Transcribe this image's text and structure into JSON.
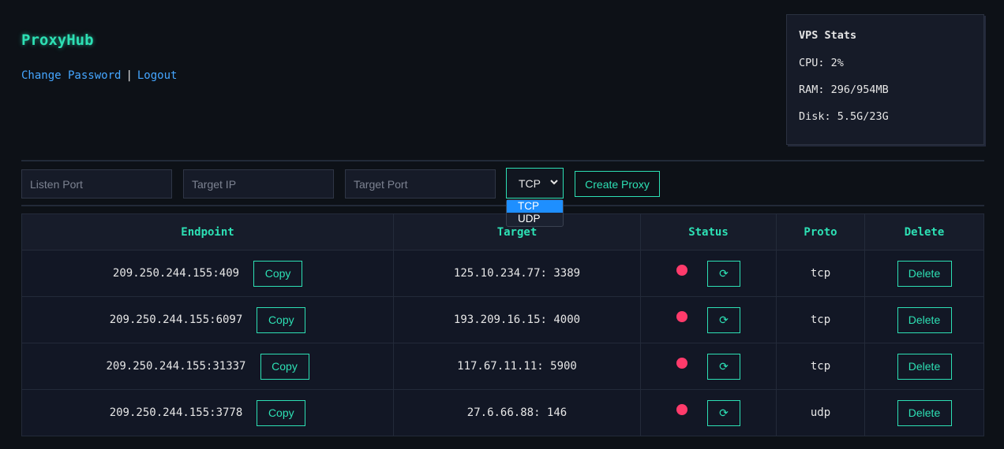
{
  "app": {
    "title": "ProxyHub",
    "links": {
      "change_password": "Change Password",
      "separator": "|",
      "logout": "Logout"
    }
  },
  "vps_stats": {
    "title": "VPS Stats",
    "cpu": "CPU: 2%",
    "ram": "RAM: 296/954MB",
    "disk": "Disk: 5.5G/23G"
  },
  "form": {
    "listen_port_placeholder": "Listen Port",
    "target_ip_placeholder": "Target IP",
    "target_port_placeholder": "Target Port",
    "protocol_selected": "TCP",
    "protocol_options": [
      "TCP",
      "UDP"
    ],
    "create_label": "Create Proxy"
  },
  "table": {
    "headers": {
      "endpoint": "Endpoint",
      "target": "Target",
      "status": "Status",
      "proto": "Proto",
      "delete": "Delete"
    },
    "copy_label": "Copy",
    "delete_label": "Delete",
    "refresh_glyph": "⟳",
    "rows": [
      {
        "endpoint": "209.250.244.155:409",
        "target": "125.10.234.77: 3389",
        "proto": "tcp",
        "status_color": "#ff3b6b"
      },
      {
        "endpoint": "209.250.244.155:6097",
        "target": "193.209.16.15: 4000",
        "proto": "tcp",
        "status_color": "#ff3b6b"
      },
      {
        "endpoint": "209.250.244.155:31337",
        "target": "117.67.11.11: 5900",
        "proto": "tcp",
        "status_color": "#ff3b6b"
      },
      {
        "endpoint": "209.250.244.155:3778",
        "target": "27.6.66.88: 146",
        "proto": "udp",
        "status_color": "#ff3b6b"
      }
    ]
  },
  "colors": {
    "accent": "#2de0b4",
    "link": "#45a6ff",
    "status_down": "#ff3b6b",
    "background": "#0d1117"
  }
}
